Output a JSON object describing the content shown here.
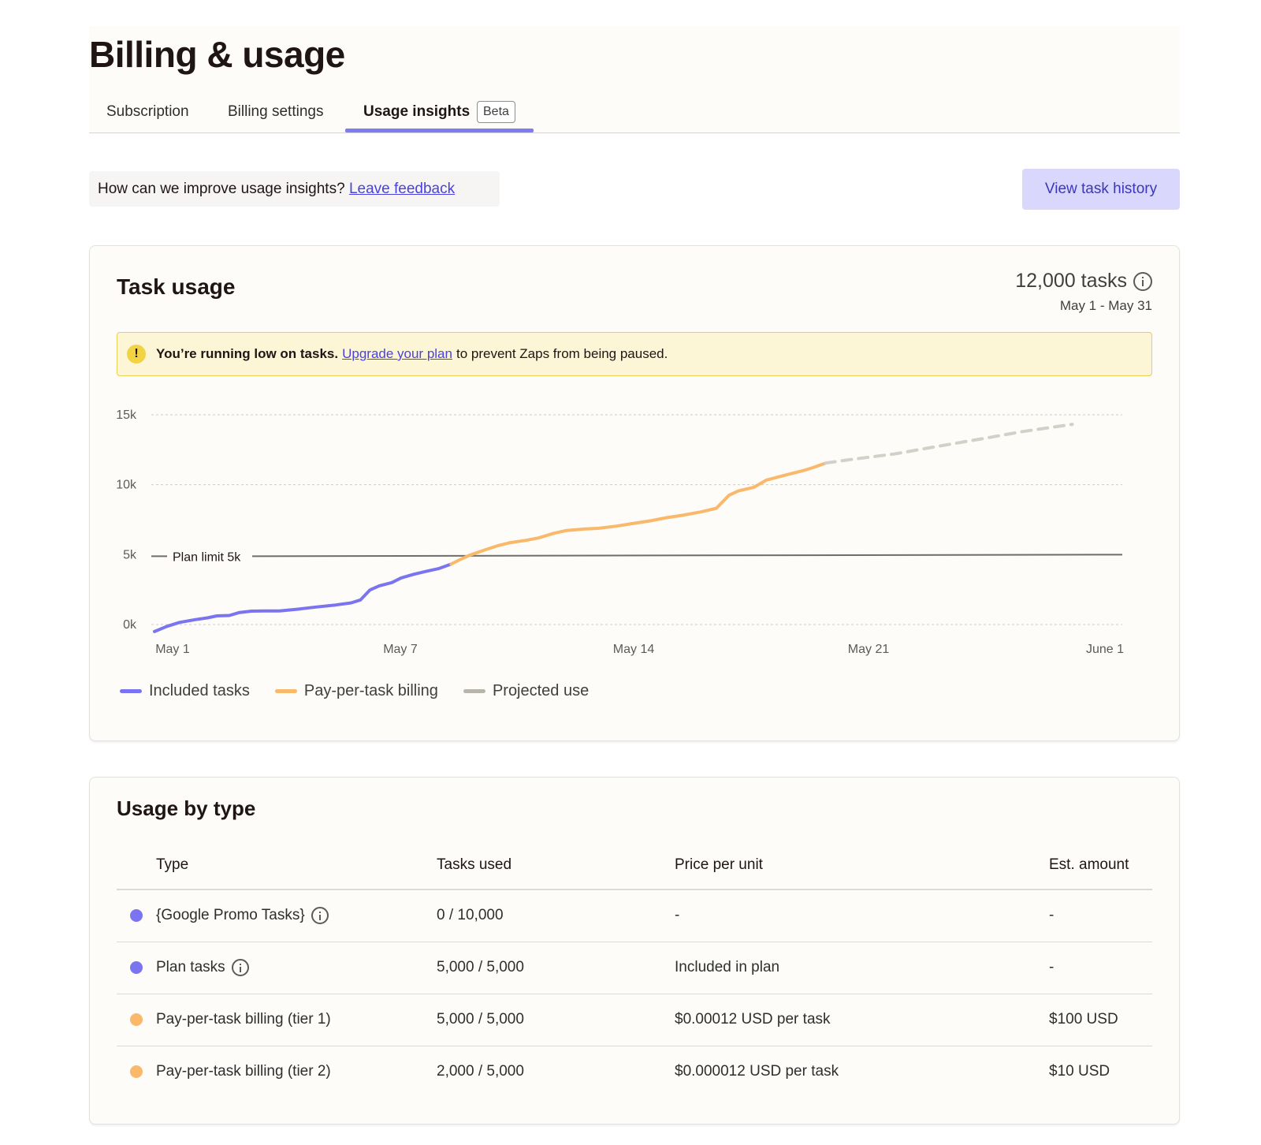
{
  "page": {
    "title": "Billing & usage"
  },
  "tabs": [
    {
      "label": "Subscription",
      "active": false
    },
    {
      "label": "Billing settings",
      "active": false
    },
    {
      "label": "Usage insights",
      "active": true,
      "badge": "Beta"
    }
  ],
  "feedback": {
    "prompt": "How can we improve usage insights?",
    "link": "Leave feedback"
  },
  "history_button": "View task history",
  "task_usage": {
    "title": "Task usage",
    "total": "12,000 tasks",
    "date_range": "May 1 - May 31",
    "alert": {
      "bold": "You’re running low on tasks.",
      "link": "Upgrade your plan",
      "rest": "to prevent Zaps from being paused."
    },
    "legend": [
      {
        "label": "Included tasks",
        "color": "#7b74f0"
      },
      {
        "label": "Pay-per-task billing",
        "color": "#f9b86a"
      },
      {
        "label": "Projected use",
        "color": "#b8b5ad"
      }
    ]
  },
  "chart_data": {
    "type": "line",
    "xlabel": "",
    "ylabel": "",
    "y_ticks": [
      "0k",
      "5k",
      "10k",
      "15k"
    ],
    "ylim": [
      0,
      15000
    ],
    "x_ticks": [
      "May 1",
      "May 7",
      "May 14",
      "May 21",
      "June 1"
    ],
    "grid": true,
    "plan_limit": {
      "label": "Plan limit 5k",
      "value": 5000
    },
    "series": [
      {
        "name": "Included tasks",
        "color": "#7b74f0",
        "style": "solid",
        "points": [
          [
            0,
            -500
          ],
          [
            0.4,
            -130
          ],
          [
            0.8,
            150
          ],
          [
            1.3,
            350
          ],
          [
            1.7,
            480
          ],
          [
            2.0,
            620
          ],
          [
            2.4,
            650
          ],
          [
            2.7,
            850
          ],
          [
            3.1,
            960
          ],
          [
            3.5,
            970
          ],
          [
            4.0,
            970
          ],
          [
            4.6,
            1100
          ],
          [
            5.2,
            1260
          ],
          [
            5.8,
            1400
          ],
          [
            6.3,
            1550
          ],
          [
            6.6,
            1760
          ],
          [
            6.9,
            2470
          ],
          [
            7.2,
            2770
          ],
          [
            7.6,
            3000
          ],
          [
            7.9,
            3330
          ],
          [
            8.3,
            3590
          ],
          [
            8.7,
            3800
          ],
          [
            9.1,
            4000
          ],
          [
            9.5,
            4320
          ]
        ]
      },
      {
        "name": "Pay-per-task billing",
        "color": "#f9b86a",
        "style": "solid",
        "points": [
          [
            9.5,
            4320
          ],
          [
            9.8,
            4660
          ],
          [
            10.1,
            4960
          ],
          [
            10.6,
            5350
          ],
          [
            11.0,
            5640
          ],
          [
            11.4,
            5860
          ],
          [
            11.9,
            6020
          ],
          [
            12.3,
            6190
          ],
          [
            12.8,
            6530
          ],
          [
            13.2,
            6730
          ],
          [
            13.8,
            6840
          ],
          [
            14.2,
            6880
          ],
          [
            14.8,
            7040
          ],
          [
            15.3,
            7220
          ],
          [
            15.9,
            7420
          ],
          [
            16.4,
            7640
          ],
          [
            16.9,
            7810
          ],
          [
            17.5,
            8050
          ],
          [
            18.0,
            8320
          ],
          [
            18.4,
            9240
          ],
          [
            18.7,
            9550
          ],
          [
            19.2,
            9820
          ],
          [
            19.6,
            10330
          ],
          [
            20.2,
            10680
          ],
          [
            20.8,
            11020
          ],
          [
            21.1,
            11230
          ],
          [
            21.5,
            11550
          ]
        ]
      },
      {
        "name": "Projected use",
        "color": "#d3d0c8",
        "style": "dashed",
        "points": [
          [
            21.5,
            11550
          ],
          [
            22.3,
            11800
          ],
          [
            23.7,
            12200
          ],
          [
            25.1,
            12750
          ],
          [
            26.6,
            13320
          ],
          [
            27.8,
            13800
          ],
          [
            29.4,
            14320
          ]
        ]
      }
    ]
  },
  "usage_by_type": {
    "title": "Usage by type",
    "columns": [
      "Type",
      "Tasks used",
      "Price per unit",
      "Est. amount"
    ],
    "rows": [
      {
        "type": "{Google Promo Tasks}",
        "info": true,
        "tasks_used": "0 / 10,000",
        "price": "-",
        "amount": "-",
        "color": "#7b74f0"
      },
      {
        "type": "Plan tasks",
        "info": true,
        "tasks_used": "5,000 / 5,000",
        "price": "Included in plan",
        "amount": "-",
        "color": "#7b74f0"
      },
      {
        "type": "Pay-per-task billing (tier 1)",
        "info": false,
        "tasks_used": "5,000 / 5,000",
        "price": "$0.00012 USD per task",
        "amount": "$100 USD",
        "color": "#f9b86a"
      },
      {
        "type": "Pay-per-task billing (tier 2)",
        "info": false,
        "tasks_used": "2,000 / 5,000",
        "price": "$0.000012 USD per task",
        "amount": "$10 USD",
        "color": "#f9b86a"
      }
    ]
  }
}
